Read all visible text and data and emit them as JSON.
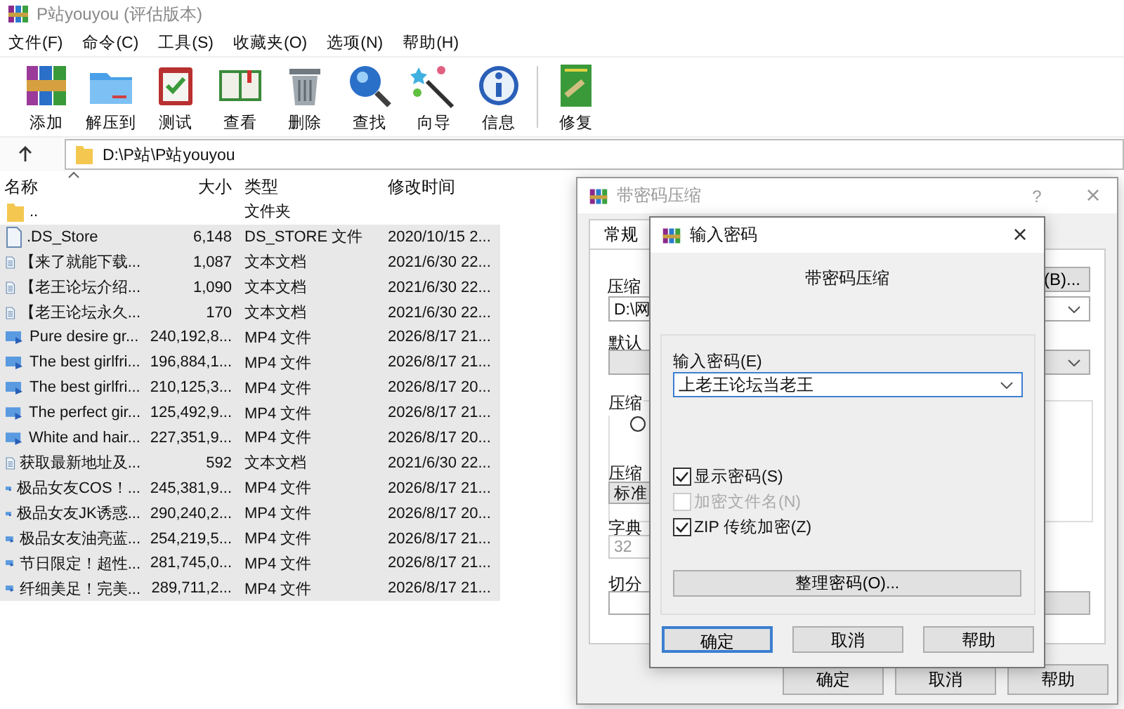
{
  "window": {
    "title": "P站youyou (评估版本)"
  },
  "menu": [
    "文件(F)",
    "命令(C)",
    "工具(S)",
    "收藏夹(O)",
    "选项(N)",
    "帮助(H)"
  ],
  "toolbar": {
    "groups": [
      {
        "buttons": [
          {
            "label": "添加",
            "kind": "add"
          },
          {
            "label": "解压到",
            "kind": "extract"
          },
          {
            "label": "测试",
            "kind": "test"
          },
          {
            "label": "查看",
            "kind": "view"
          },
          {
            "label": "删除",
            "kind": "delete"
          },
          {
            "label": "查找",
            "kind": "find"
          },
          {
            "label": "向导",
            "kind": "wizard"
          },
          {
            "label": "信息",
            "kind": "info"
          }
        ]
      },
      {
        "buttons": [
          {
            "label": "修复",
            "kind": "repair"
          }
        ]
      }
    ]
  },
  "address": {
    "path": "D:\\P站\\P站youyou"
  },
  "file_list": {
    "columns": [
      {
        "label": "名称",
        "sorted": true
      },
      {
        "label": "大小",
        "sorted": false
      },
      {
        "label": "类型",
        "sorted": false
      },
      {
        "label": "修改时间",
        "sorted": false
      }
    ],
    "rows": [
      {
        "kind": "folder",
        "name": "..",
        "size": "",
        "type": "文件夹",
        "modified": "",
        "selected": false
      },
      {
        "kind": "file",
        "name": ".DS_Store",
        "size": "6,148",
        "type": "DS_STORE 文件",
        "modified": "2020/10/15 2...",
        "selected": true
      },
      {
        "kind": "text",
        "name": "【来了就能下载...",
        "size": "1,087",
        "type": "文本文档",
        "modified": "2021/6/30 22...",
        "selected": true
      },
      {
        "kind": "text",
        "name": "【老王论坛介绍...",
        "size": "1,090",
        "type": "文本文档",
        "modified": "2021/6/30 22...",
        "selected": true
      },
      {
        "kind": "text",
        "name": "【老王论坛永久...",
        "size": "170",
        "type": "文本文档",
        "modified": "2021/6/30 22...",
        "selected": true
      },
      {
        "kind": "video",
        "name": "Pure desire gr...",
        "size": "240,192,8...",
        "type": "MP4 文件",
        "modified": "2026/8/17 21...",
        "selected": true
      },
      {
        "kind": "video",
        "name": "The best girlfri...",
        "size": "196,884,1...",
        "type": "MP4 文件",
        "modified": "2026/8/17 21...",
        "selected": true
      },
      {
        "kind": "video",
        "name": "The best girlfri...",
        "size": "210,125,3...",
        "type": "MP4 文件",
        "modified": "2026/8/17 20...",
        "selected": true
      },
      {
        "kind": "video",
        "name": "The perfect gir...",
        "size": "125,492,9...",
        "type": "MP4 文件",
        "modified": "2026/8/17 21...",
        "selected": true
      },
      {
        "kind": "video",
        "name": "White and hair...",
        "size": "227,351,9...",
        "type": "MP4 文件",
        "modified": "2026/8/17 20...",
        "selected": true
      },
      {
        "kind": "text",
        "name": "获取最新地址及...",
        "size": "592",
        "type": "文本文档",
        "modified": "2021/6/30 22...",
        "selected": true
      },
      {
        "kind": "video",
        "name": "极品女友COS！...",
        "size": "245,381,9...",
        "type": "MP4 文件",
        "modified": "2026/8/17 21...",
        "selected": true
      },
      {
        "kind": "video",
        "name": "极品女友JK诱惑...",
        "size": "290,240,2...",
        "type": "MP4 文件",
        "modified": "2026/8/17 20...",
        "selected": true
      },
      {
        "kind": "video",
        "name": "极品女友油亮蓝...",
        "size": "254,219,5...",
        "type": "MP4 文件",
        "modified": "2026/8/17 21...",
        "selected": true
      },
      {
        "kind": "video",
        "name": "节日限定！超性...",
        "size": "281,745,0...",
        "type": "MP4 文件",
        "modified": "2026/8/17 21...",
        "selected": true
      },
      {
        "kind": "video",
        "name": "纤细美足！完美...",
        "size": "289,711,2...",
        "type": "MP4 文件",
        "modified": "2026/8/17 21...",
        "selected": true
      }
    ]
  },
  "archive_dialog": {
    "title": "带密码压缩",
    "help": "?",
    "close": "×",
    "tab": "常规",
    "archive_label": "压缩",
    "browse_button": "(B)...",
    "archive_path": "D:\\网",
    "profile_label": "默认",
    "format_group": "压缩",
    "format_radio_checked": false,
    "method_label": "压缩",
    "method": "标准",
    "dict_label": "字典",
    "dict": "32",
    "split_label": "切分",
    "buttons": [
      "确定",
      "取消",
      "帮助"
    ]
  },
  "password_dialog": {
    "title": "输入密码",
    "close": "×",
    "heading": "带密码压缩",
    "password_label": "输入密码(E)",
    "password": "上老王论坛当老王",
    "options": [
      {
        "label": "显示密码(S)",
        "checked": true,
        "disabled": false
      },
      {
        "label": "加密文件名(N)",
        "checked": false,
        "disabled": true
      },
      {
        "label": "ZIP 传统加密(Z)",
        "checked": true,
        "disabled": false
      }
    ],
    "organize_button": "整理密码(O)...",
    "buttons": [
      {
        "label": "确定",
        "selected": true
      },
      {
        "label": "取消",
        "selected": false
      },
      {
        "label": "帮助",
        "selected": false
      }
    ]
  }
}
